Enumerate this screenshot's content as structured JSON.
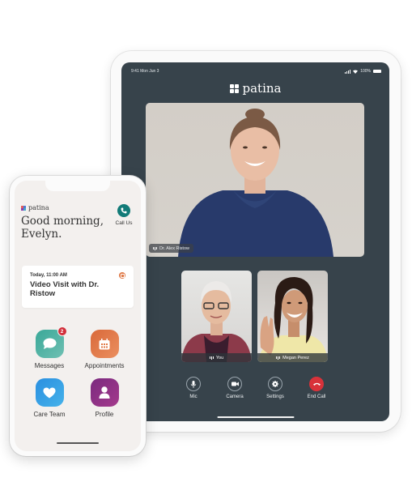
{
  "tablet": {
    "status_time": "9:41 Mon Jun 3",
    "battery": "100%",
    "brand": "patina",
    "main_participant": "Dr. Alex Ristow",
    "participants": [
      {
        "label": "You"
      },
      {
        "label": "Megan Perez"
      }
    ],
    "controls": [
      {
        "label": "Mic",
        "icon": "microphone-icon"
      },
      {
        "label": "Camera",
        "icon": "video-camera-icon"
      },
      {
        "label": "Settings",
        "icon": "gear-icon"
      },
      {
        "label": "End Call",
        "icon": "hang-up-icon"
      }
    ],
    "colors": {
      "screen_bg": "#37434b",
      "end_call": "#d8323a"
    }
  },
  "phone": {
    "brand": "patina",
    "greeting": "Good morning, Evelyn.",
    "call_us": "Call Us",
    "appointment": {
      "time": "Today, 11:00 AM",
      "title": "Video Visit with Dr. Ristow"
    },
    "tiles": [
      {
        "label": "Messages",
        "badge": "2",
        "color": "#4fb0a4"
      },
      {
        "label": "Appointments",
        "color": "#e07a48"
      },
      {
        "label": "Care Team",
        "color": "#2f95d9"
      },
      {
        "label": "Profile",
        "color": "#8f2d82"
      }
    ],
    "colors": {
      "call": "#127b78",
      "notif": "#d22f3a"
    }
  }
}
